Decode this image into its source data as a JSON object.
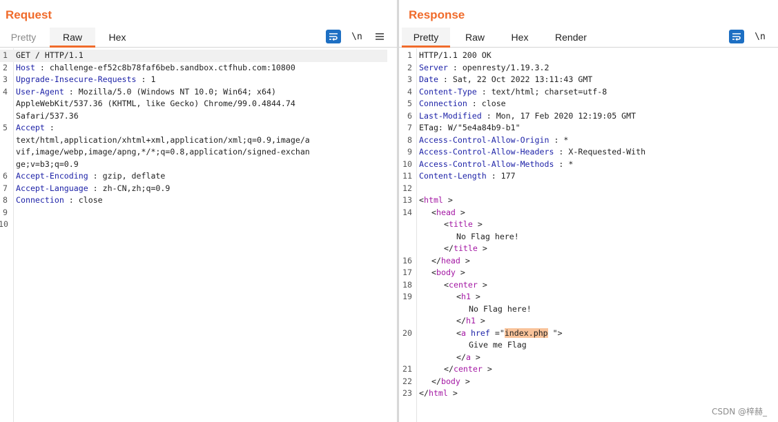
{
  "request": {
    "title": "Request",
    "tabs": [
      "Pretty",
      "Raw",
      "Hex"
    ],
    "active_tab": "Raw",
    "newline_label": "\\n",
    "lines": [
      {
        "n": "1",
        "k": "",
        "t": "GET / HTTP/1.1"
      },
      {
        "n": "2",
        "k": "Host",
        "t": " : challenge-ef52c8b78faf6beb.sandbox.ctfhub.com:10800"
      },
      {
        "n": "3",
        "k": "Upgrade-Insecure-Requests",
        "t": " : 1"
      },
      {
        "n": "4",
        "k": "User-Agent",
        "t": " : Mozilla/5.0 (Windows NT 10.0; Win64; x64)"
      },
      {
        "n": "",
        "k": "",
        "t": "AppleWebKit/537.36 (KHTML, like Gecko) Chrome/99.0.4844.74"
      },
      {
        "n": "",
        "k": "",
        "t": "Safari/537.36"
      },
      {
        "n": "5",
        "k": "Accept",
        "t": " :"
      },
      {
        "n": "",
        "k": "",
        "t": "text/html,application/xhtml+xml,application/xml;q=0.9,image/a"
      },
      {
        "n": "",
        "k": "",
        "t": "vif,image/webp,image/apng,*/*;q=0.8,application/signed-exchan"
      },
      {
        "n": "",
        "k": "",
        "t": "ge;v=b3;q=0.9"
      },
      {
        "n": "6",
        "k": "Accept-Encoding",
        "t": " : gzip, deflate"
      },
      {
        "n": "7",
        "k": "Accept-Language",
        "t": " : zh-CN,zh;q=0.9"
      },
      {
        "n": "8",
        "k": "Connection",
        "t": " : close"
      },
      {
        "n": "9",
        "k": "",
        "t": ""
      },
      {
        "n": "10",
        "k": "",
        "t": ""
      }
    ]
  },
  "response": {
    "title": "Response",
    "tabs": [
      "Pretty",
      "Raw",
      "Hex",
      "Render"
    ],
    "active_tab": "Pretty",
    "newline_label": "\\n",
    "header_lines": [
      {
        "n": "1",
        "k": "",
        "t": "HTTP/1.1 200 OK"
      },
      {
        "n": "2",
        "k": "Server",
        "t": " : openresty/1.19.3.2"
      },
      {
        "n": "3",
        "k": "Date",
        "t": " : Sat, 22 Oct 2022 13:11:43 GMT"
      },
      {
        "n": "4",
        "k": "Content-Type",
        "t": " : text/html; charset=utf-8"
      },
      {
        "n": "5",
        "k": "Connection",
        "t": " : close"
      },
      {
        "n": "6",
        "k": "Last-Modified",
        "t": " : Mon, 17 Feb 2020 12:19:05 GMT"
      },
      {
        "n": "7",
        "k": "",
        "t": "ETag: W/\"5e4a84b9-b1\""
      },
      {
        "n": "8",
        "k": "Access-Control-Allow-Origin",
        "t": " : *"
      },
      {
        "n": "9",
        "k": "Access-Control-Allow-Headers",
        "t": " : X-Requested-With"
      },
      {
        "n": "10",
        "k": "Access-Control-Allow-Methods",
        "t": " : *"
      },
      {
        "n": "11",
        "k": "Content-Length",
        "t": " : 177"
      },
      {
        "n": "12",
        "k": "",
        "t": ""
      }
    ],
    "body_lines": [
      {
        "n": "13",
        "indent": 0,
        "kind": "open",
        "tag": "html"
      },
      {
        "n": "14",
        "indent": 1,
        "kind": "open",
        "tag": "head"
      },
      {
        "n": "",
        "indent": 2,
        "kind": "open",
        "tag": "title"
      },
      {
        "n": "",
        "indent": 3,
        "kind": "text",
        "text": "No Flag here!"
      },
      {
        "n": "",
        "indent": 2,
        "kind": "close",
        "tag": "title"
      },
      {
        "n": "16",
        "indent": 1,
        "kind": "close",
        "tag": "head"
      },
      {
        "n": "17",
        "indent": 1,
        "kind": "open",
        "tag": "body"
      },
      {
        "n": "18",
        "indent": 2,
        "kind": "open",
        "tag": "center"
      },
      {
        "n": "19",
        "indent": 3,
        "kind": "open",
        "tag": "h1"
      },
      {
        "n": "",
        "indent": 4,
        "kind": "text",
        "text": "No Flag here!"
      },
      {
        "n": "",
        "indent": 3,
        "kind": "close",
        "tag": "h1"
      },
      {
        "n": "20",
        "indent": 3,
        "kind": "anchor",
        "tag": "a",
        "attr": "href",
        "value": "index.php"
      },
      {
        "n": "",
        "indent": 4,
        "kind": "text",
        "text": "Give me Flag"
      },
      {
        "n": "",
        "indent": 3,
        "kind": "close",
        "tag": "a"
      },
      {
        "n": "21",
        "indent": 2,
        "kind": "close",
        "tag": "center"
      },
      {
        "n": "22",
        "indent": 1,
        "kind": "close",
        "tag": "body"
      },
      {
        "n": "23",
        "indent": 0,
        "kind": "close",
        "tag": "html"
      }
    ]
  },
  "watermark": "CSDN @梓赫_",
  "colors": {
    "accent": "#f06b2b",
    "key": "#1e23a8",
    "tag": "#a317a3",
    "highlight": "#f9c39a",
    "button_blue": "#1d6fc3"
  },
  "icons": {
    "wrap": "word-wrap-icon",
    "menu": "hamburger-menu-icon",
    "layout_split": "split-layout-icon",
    "layout_stack": "stacked-layout-icon"
  }
}
